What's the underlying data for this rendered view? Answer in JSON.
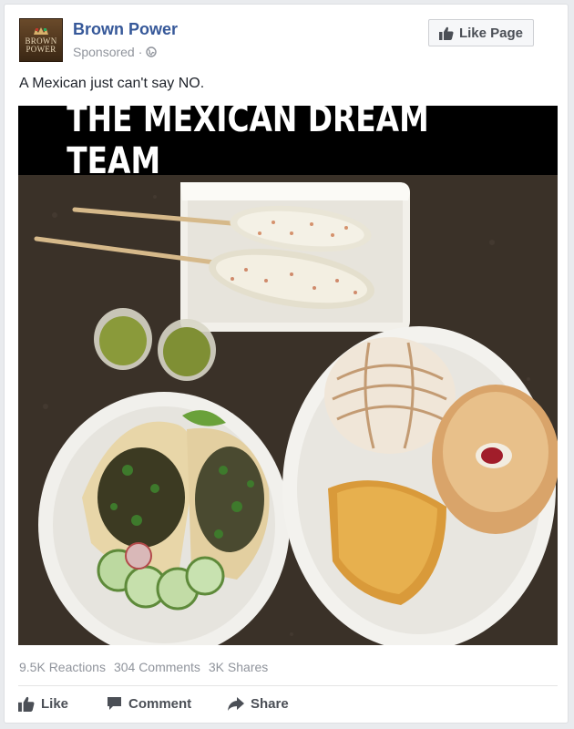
{
  "post": {
    "page_name": "Brown Power",
    "avatar_logo": {
      "line1": "BROWN",
      "line2": "POWER"
    },
    "sponsored": "Sponsored",
    "meta_sep": "·",
    "globe_icon": "globe-icon",
    "like_page_label": "Like Page",
    "text": "A Mexican just can't say NO.",
    "image_caption": "THE MEXICAN DREAM TEAM"
  },
  "stats": {
    "reactions": "9.5K Reactions",
    "comments": "304 Comments",
    "shares": "3K Shares"
  },
  "actions": {
    "like": "Like",
    "comment": "Comment",
    "share": "Share"
  },
  "colors": {
    "brand": "#365899",
    "muted": "#90949c",
    "action_text": "#4b4f56"
  }
}
